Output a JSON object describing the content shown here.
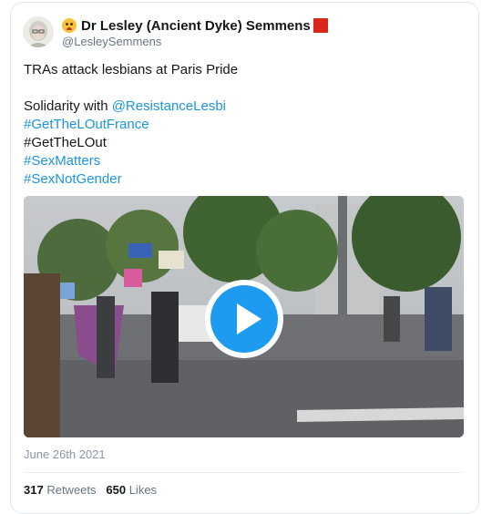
{
  "tweet": {
    "author": {
      "name": "Dr Lesley (Ancient Dyke) Semmens",
      "handle": "@LesleySemmens",
      "name_prefix_icon": "worried-face-emoji",
      "name_suffix_icon": "red-square-emoji"
    },
    "lines": [
      {
        "text": "TRAs attack lesbians at Paris Pride",
        "type": "text"
      },
      {
        "text": "",
        "type": "blank"
      },
      {
        "text": "Solidarity with ",
        "type": "text",
        "mention": "@ResistanceLesbi"
      },
      {
        "text": "#GetTheLOutFrance",
        "type": "hashtag"
      },
      {
        "text": "#GetTheLOut",
        "type": "text"
      },
      {
        "text": "#SexMatters",
        "type": "hashtag"
      },
      {
        "text": "#SexNotGender",
        "type": "hashtag"
      }
    ],
    "media": {
      "type": "video",
      "play_icon": "play-icon"
    },
    "date": "June 26th 2021",
    "retweets": "317",
    "retweets_label": "Retweets",
    "likes": "650",
    "likes_label": "Likes"
  },
  "colors": {
    "link": "#1b95e0",
    "play": "#1d9bf0"
  }
}
